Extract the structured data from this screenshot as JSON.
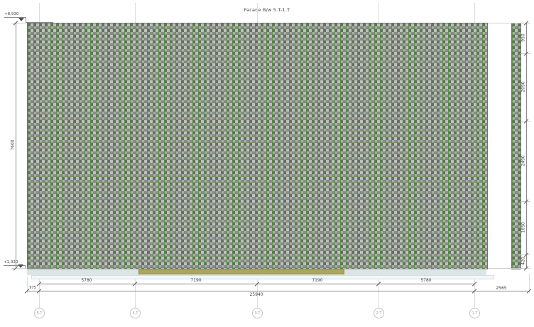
{
  "title": "Facade B/w 5.T-1.T",
  "levels": {
    "top_label": "+8,930",
    "bottom_label": "+1,330"
  },
  "dims": {
    "left_overall": "7600",
    "right_chain": [
      "950",
      "2090",
      "2490",
      "1650",
      "420"
    ],
    "bottom_row1": [
      "5780",
      "7190",
      "7190",
      "5780"
    ],
    "bottom_left": "975",
    "bottom_overall": "25940",
    "bottom_right": "2565"
  },
  "grid_bubbles": [
    "5.T",
    "4.T",
    "3.T",
    "2.T",
    "1.T"
  ],
  "colors": {
    "mesh_gray": "#9fa59d",
    "mesh_green": "#568e42",
    "olive_strip": "#aaa65c",
    "base_band": "#dde4e6",
    "line_gray": "#8a8a8a"
  }
}
